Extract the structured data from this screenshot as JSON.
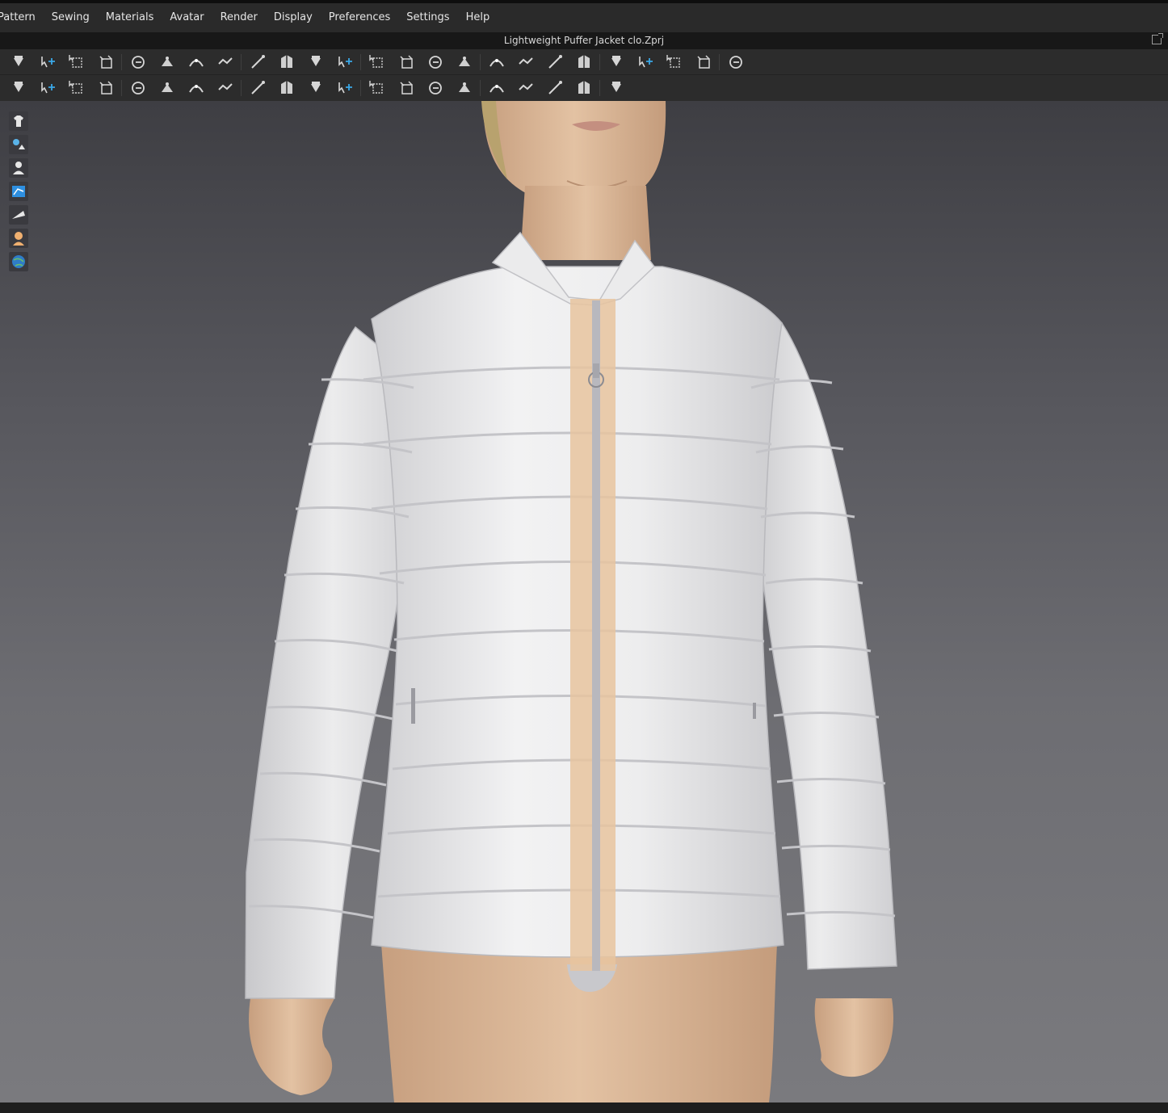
{
  "menu": [
    {
      "label": "Pattern"
    },
    {
      "label": "Sewing"
    },
    {
      "label": "Materials"
    },
    {
      "label": "Avatar"
    },
    {
      "label": "Render"
    },
    {
      "label": "Display"
    },
    {
      "label": "Preferences"
    },
    {
      "label": "Settings"
    },
    {
      "label": "Help"
    }
  ],
  "window": {
    "title": "Lightweight Puffer Jacket clo.Zprj"
  },
  "colors": {
    "accent": "#3aa8e8",
    "panel": "#2c2c2c",
    "viewport_top": "#3e3e43",
    "viewport_bottom": "#7a7a7e",
    "jacket": "#e8e8ea",
    "skin": "#d9b99a",
    "zipper_tape": "#e8c49f"
  },
  "toolbar_row1": [
    "simulation-icon",
    "select-move-icon",
    "transform-pattern-icon",
    "edit-pattern-icon",
    "fold-arrangement-icon",
    "move-pin-icon",
    "add-point-icon",
    "curve-point-icon",
    "edit-curvature-icon",
    "segment-sewing-icon",
    "free-sewing-icon",
    "check-sewing-icon",
    "arrangement-icon",
    "reset-arrangement-icon",
    "show-garment-icon",
    "raise-garment-icon",
    "lower-garment-icon",
    "fold-garment-icon",
    "tack-icon",
    "stack-icon",
    "stitch-icon",
    "stretch-icon",
    "measure-curve-icon",
    "tape-measure-icon",
    "ruler-icon"
  ],
  "toolbar_row2": [
    "pose-avatar-icon",
    "pin-icon",
    "magic-pin-icon",
    "stitch-3d-icon",
    "seam-taping-icon",
    "copy-sheet-icon",
    "edit-texture-icon",
    "graphic-icon",
    "puckering-icon",
    "button-icon",
    "select-button-icon",
    "buttonhole-icon",
    "attach-icon",
    "zipper-icon",
    "piping-icon",
    "elastic-icon",
    "piece-icon",
    "shirring-icon",
    "fold-in-icon",
    "fold-out-icon",
    "shape-icon"
  ],
  "sidebar": [
    "garment-display-icon",
    "avatar-texture-icon",
    "avatar-display-icon",
    "fabric-mode-icon",
    "thickness-icon",
    "skin-icon",
    "environment-icon"
  ]
}
